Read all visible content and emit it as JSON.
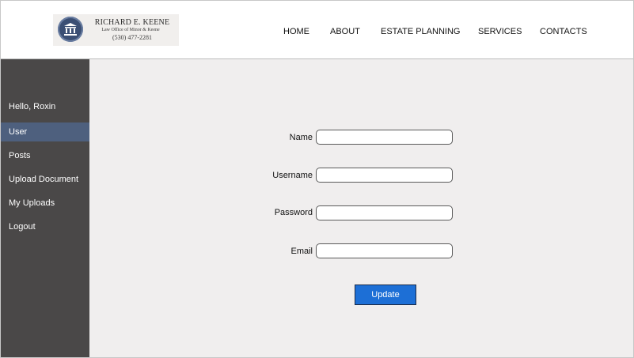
{
  "header": {
    "logo": {
      "name": "RICHARD E. KEENE",
      "subtitle": "Law Office of Minor & Keene",
      "phone": "(530) 477-2281"
    },
    "nav": [
      "HOME",
      "ABOUT",
      "ESTATE PLANNING",
      "SERVICES",
      "CONTACTS"
    ]
  },
  "sidebar": {
    "greeting": "Hello, Roxin",
    "items": [
      {
        "label": "User",
        "active": true
      },
      {
        "label": "Posts",
        "active": false
      },
      {
        "label": "Upload Document",
        "active": false
      },
      {
        "label": "My Uploads",
        "active": false
      },
      {
        "label": "Logout",
        "active": false
      }
    ],
    "active_color": "#4e607e",
    "background": "#4a4848"
  },
  "form": {
    "fields": [
      {
        "label": "Name",
        "value": "",
        "placeholder": ""
      },
      {
        "label": "Username",
        "value": "",
        "placeholder": ""
      },
      {
        "label": "Password",
        "value": "",
        "placeholder": ""
      },
      {
        "label": "Email",
        "value": "",
        "placeholder": ""
      }
    ],
    "submit_label": "Update",
    "submit_color": "#1d6fd6"
  }
}
